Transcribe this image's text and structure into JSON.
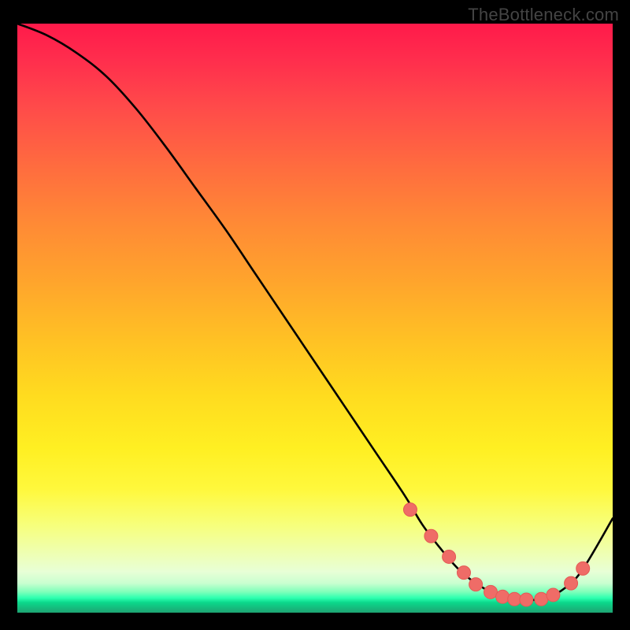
{
  "watermark": "TheBottleneck.com",
  "colors": {
    "curve_stroke": "#000000",
    "marker_fill": "#ef6c67",
    "marker_stroke": "#e45a55"
  },
  "chart_data": {
    "type": "line",
    "title": "",
    "xlabel": "",
    "ylabel": "",
    "xlim": [
      0,
      100
    ],
    "ylim": [
      0,
      100
    ],
    "series": [
      {
        "name": "bottleneck-curve",
        "x": [
          0,
          5,
          10,
          15,
          20,
          25,
          30,
          35,
          40,
          45,
          50,
          55,
          60,
          65,
          68,
          71,
          74,
          77,
          80,
          83,
          86,
          89,
          92,
          95,
          100
        ],
        "y": [
          100,
          98,
          95,
          91,
          85.5,
          79,
          72,
          65,
          57.5,
          50,
          42.5,
          35,
          27.5,
          20,
          15,
          11,
          7.5,
          5,
          3.3,
          2.3,
          2.1,
          2.6,
          4.2,
          7.4,
          16
        ]
      }
    ],
    "markers": {
      "name": "scatter-points",
      "x": [
        66,
        69.5,
        72.5,
        75,
        77,
        79.5,
        81.5,
        83.5,
        85.5,
        88,
        90,
        93,
        95
      ],
      "y": [
        17.5,
        13,
        9.5,
        6.8,
        4.8,
        3.5,
        2.7,
        2.3,
        2.2,
        2.3,
        3.0,
        5.0,
        7.5
      ]
    }
  }
}
